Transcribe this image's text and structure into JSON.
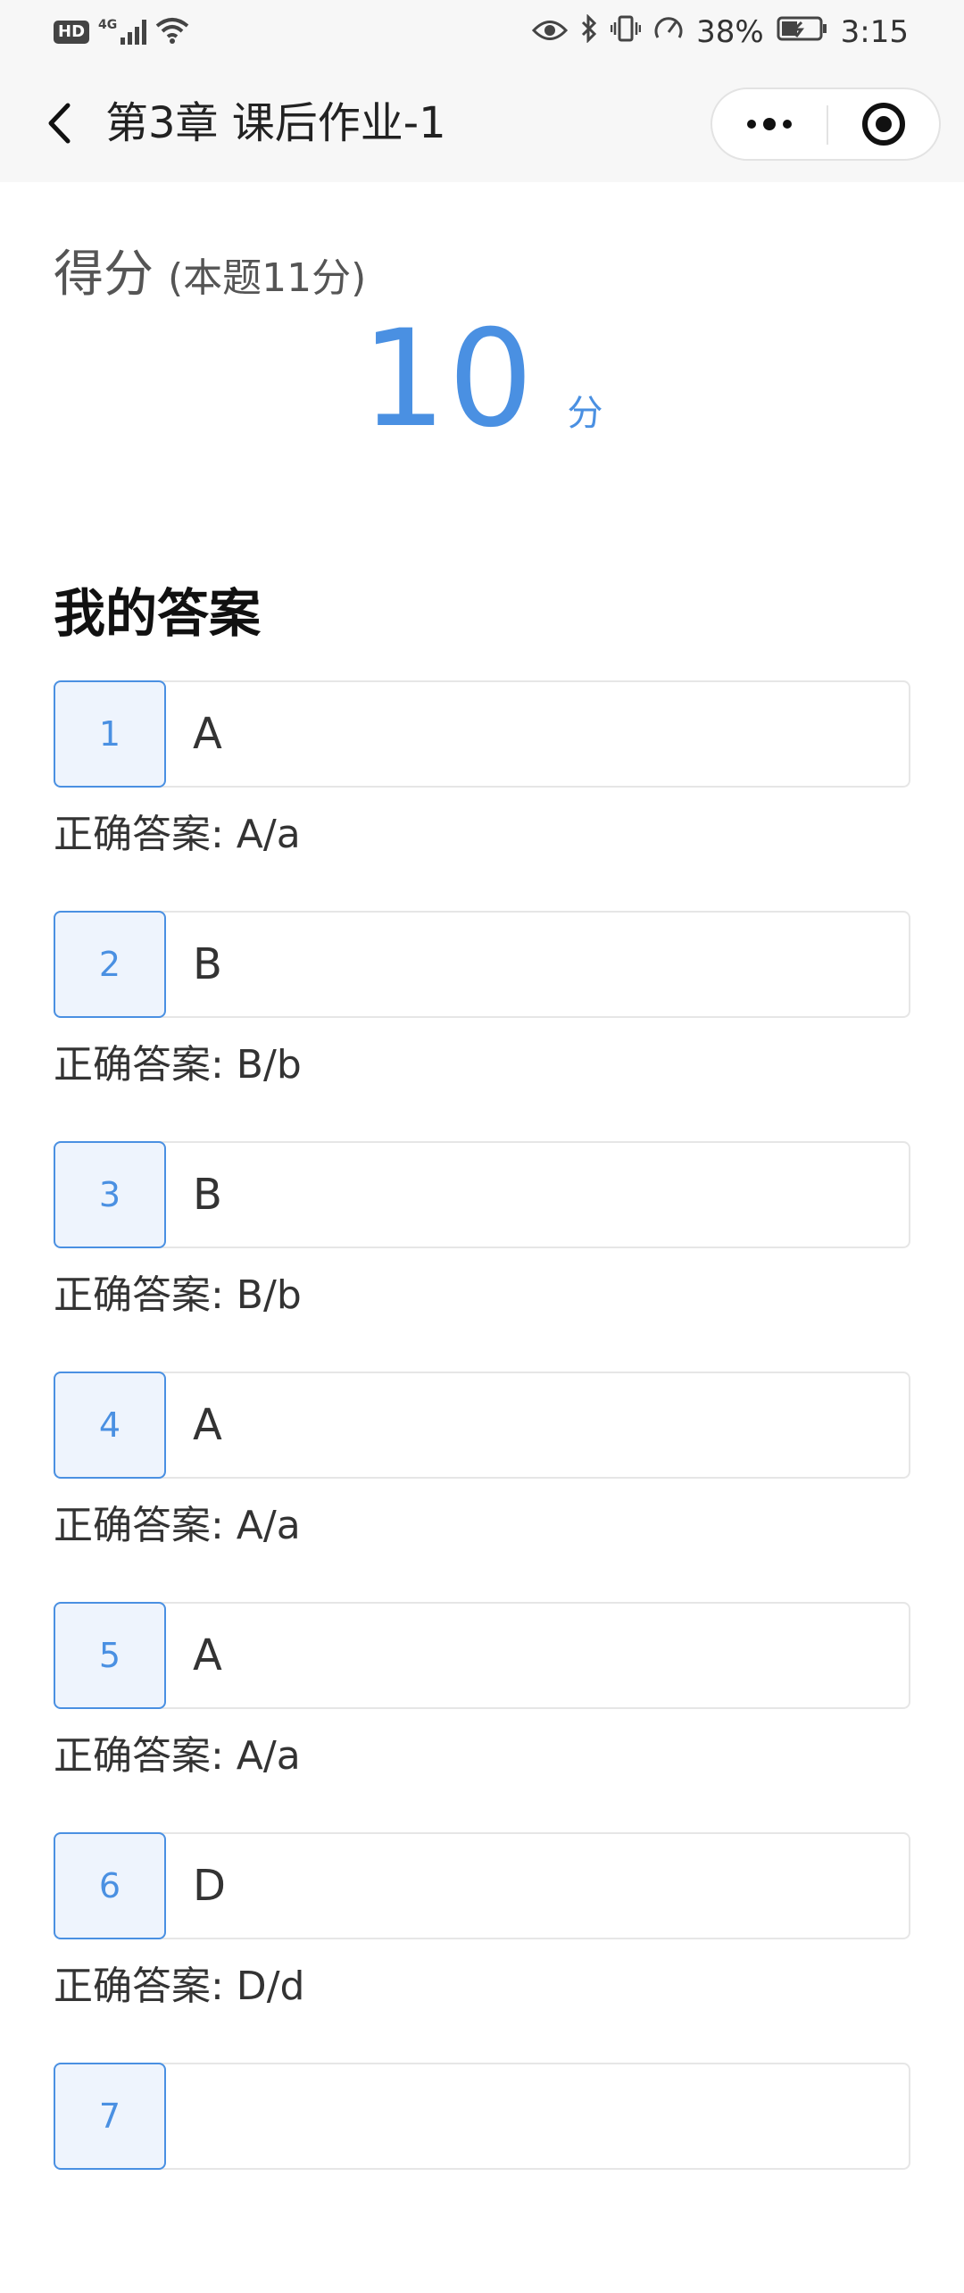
{
  "status_bar": {
    "hd": "HD",
    "network": "4G",
    "battery": "38%",
    "time": "3:15",
    "icons": [
      "eye-icon",
      "bluetooth-icon",
      "vibrate-icon",
      "speed-icon",
      "battery-icon"
    ]
  },
  "nav": {
    "title": "第3章 课后作业-1",
    "back_icon": "back-arrow-icon",
    "more_icon": "more-dots-icon",
    "close_icon": "target-circle-icon"
  },
  "score": {
    "label": "得分",
    "total_note": "(本题11分)",
    "value": "10",
    "unit": "分"
  },
  "section_title": "我的答案",
  "answers": [
    {
      "num": "1",
      "answer": "A",
      "correct": "正确答案: A/a"
    },
    {
      "num": "2",
      "answer": "B",
      "correct": "正确答案: B/b"
    },
    {
      "num": "3",
      "answer": "B",
      "correct": "正确答案: B/b"
    },
    {
      "num": "4",
      "answer": "A",
      "correct": "正确答案: A/a"
    },
    {
      "num": "5",
      "answer": "A",
      "correct": "正确答案: A/a"
    },
    {
      "num": "6",
      "answer": "D",
      "correct": "正确答案: D/d"
    },
    {
      "num": "7",
      "answer": "",
      "correct": ""
    }
  ],
  "colors": {
    "accent": "#4a90e2",
    "accent_bg": "#eef4fd",
    "nav_bg": "#f7f7f7"
  }
}
